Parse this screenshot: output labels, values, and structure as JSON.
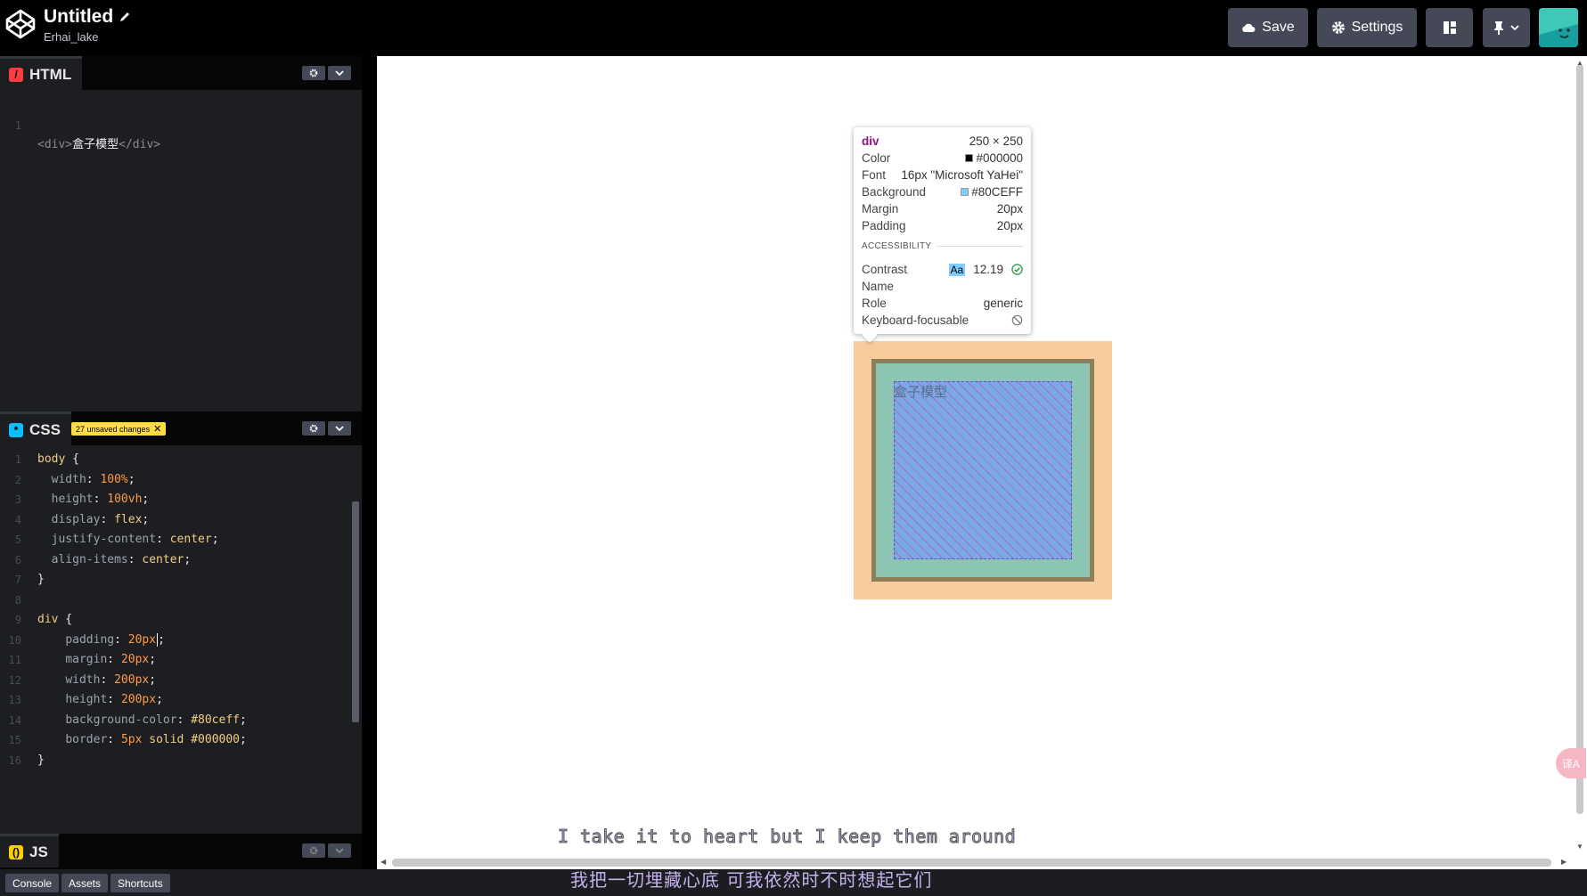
{
  "header": {
    "title": "Untitled",
    "owner": "Erhai_lake",
    "save_label": "Save",
    "settings_label": "Settings",
    "icons": [
      "codepen-logo-icon",
      "pencil-icon",
      "cloud-icon",
      "gear-icon",
      "layout-icon",
      "pin-icon",
      "chevron-down-icon"
    ]
  },
  "html_panel": {
    "label": "HTML",
    "lines": [
      {
        "num": "1",
        "open_tag": "<div>",
        "text": "盒子模型",
        "close_tag": "</div>"
      }
    ]
  },
  "css_panel": {
    "label": "CSS",
    "unsaved": "27 unsaved changes",
    "lines": [
      {
        "num": "1"
      },
      {
        "num": "2"
      },
      {
        "num": "3"
      },
      {
        "num": "4"
      },
      {
        "num": "5"
      },
      {
        "num": "6"
      },
      {
        "num": "7"
      },
      {
        "num": "8"
      },
      {
        "num": "9"
      },
      {
        "num": "10"
      },
      {
        "num": "11"
      },
      {
        "num": "12"
      },
      {
        "num": "13"
      },
      {
        "num": "14"
      },
      {
        "num": "15"
      },
      {
        "num": "16"
      }
    ],
    "code": {
      "l1_sel": "body",
      "l1_brace": " {",
      "l2_prop": "width",
      "l2_val": "100%",
      "l3_prop": "height",
      "l3_val": "100vh",
      "l4_prop": "display",
      "l4_val": "flex",
      "l5_prop": "justify-content",
      "l5_val": "center",
      "l6_prop": "align-items",
      "l6_val": "center",
      "l7": "}",
      "l9_sel": "div",
      "l9_brace": " {",
      "l10_prop": "padding",
      "l10_val": "20px",
      "l11_prop": "margin",
      "l11_val": "20px",
      "l12_prop": "width",
      "l12_val": "200px",
      "l13_prop": "height",
      "l13_val": "200px",
      "l14_prop": "background-color",
      "l14_val": "#80ceff",
      "l15_prop": "border",
      "l15_val1": "5px",
      "l15_val2": "solid",
      "l15_val3": "#000000",
      "l16": "}"
    }
  },
  "js_panel": {
    "label": "JS"
  },
  "preview": {
    "box_text": "盒子模型",
    "colors": {
      "margin": "#f9cc9d",
      "border": "#8c7f5a",
      "padding": "#8cc5b3",
      "content": "#7aa8e8"
    }
  },
  "tooltip": {
    "tag": "div",
    "size": "250 × 250",
    "color_label": "Color",
    "color_value": "#000000",
    "font_label": "Font",
    "font_value": "16px \"Microsoft YaHei\"",
    "background_label": "Background",
    "background_value": "#80CEFF",
    "margin_label": "Margin",
    "margin_value": "20px",
    "padding_label": "Padding",
    "padding_value": "20px",
    "accessibility_label": "ACCESSIBILITY",
    "contrast_label": "Contrast",
    "contrast_aa": "Aa",
    "contrast_value": "12.19",
    "name_label": "Name",
    "role_label": "Role",
    "role_value": "generic",
    "keyboard_label": "Keyboard-focusable"
  },
  "subtitles": {
    "english": "I take it to heart but I keep them around",
    "chinese": "我把一切埋藏心底  可我依然时不时想起它们"
  },
  "side_badge": "译A",
  "footer": {
    "console": "Console",
    "assets": "Assets",
    "shortcuts": "Shortcuts"
  }
}
